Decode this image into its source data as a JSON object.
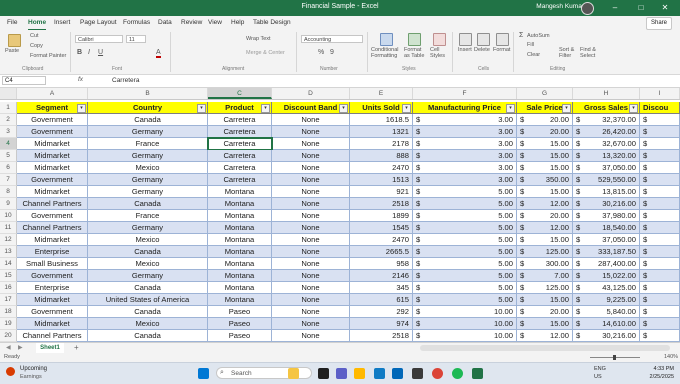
{
  "titlebar": {
    "title": "Financial Sample  -  Excel",
    "user": "Mangesh Kumar",
    "min": "–",
    "max": "□",
    "close": "✕"
  },
  "menu": {
    "tabs": [
      "File",
      "Home",
      "Insert",
      "Page Layout",
      "Formulas",
      "Data",
      "Review",
      "View",
      "Help",
      "Table Design"
    ],
    "active": "Home",
    "share": "Share"
  },
  "ribbon": {
    "paste": "Paste",
    "cut": "Cut",
    "copy": "Copy",
    "format_painter": "Format Painter",
    "font_name": "Calibri",
    "font_size": "11",
    "wrap_text": "Wrap Text",
    "merge_center": "Merge & Center",
    "number_format": "Accounting",
    "percent": "%",
    "comma": "9",
    "conditional_formatting": "Conditional Formatting",
    "format_as_table": "Format as Table",
    "cell_styles": "Cell Styles",
    "insert": "Insert",
    "delete": "Delete",
    "format": "Format",
    "autosum": "AutoSum",
    "fill": "Fill",
    "clear": "Clear",
    "sort_filter": "Sort & Filter",
    "find_select": "Find & Select",
    "groups": [
      "Clipboard",
      "Font",
      "Alignment",
      "Number",
      "Styles",
      "Cells",
      "Editing"
    ]
  },
  "formula_bar": {
    "name_box": "C4",
    "fx": "fx",
    "value": "Carretera"
  },
  "sheet": {
    "columns": [
      "A",
      "B",
      "C",
      "D",
      "E",
      "F",
      "G",
      "H",
      "I"
    ],
    "selected_column": "C",
    "selected_row": "4",
    "headers": [
      "Segment",
      "Country",
      "Product",
      "Discount Band",
      "Units Sold",
      "Manufacturing Price",
      "Sale Price",
      "Gross Sales",
      "Discou"
    ],
    "filter_glyph": "▾",
    "dollar": "$",
    "rows": [
      {
        "n": "2",
        "cells": [
          "Government",
          "Canada",
          "Carretera",
          "None",
          "1618.5",
          "3.00",
          "20.00",
          "32,370.00"
        ]
      },
      {
        "n": "3",
        "cells": [
          "Government",
          "Germany",
          "Carretera",
          "None",
          "1321",
          "3.00",
          "20.00",
          "26,420.00"
        ]
      },
      {
        "n": "4",
        "cells": [
          "Midmarket",
          "France",
          "Carretera",
          "None",
          "2178",
          "3.00",
          "15.00",
          "32,670.00"
        ]
      },
      {
        "n": "5",
        "cells": [
          "Midmarket",
          "Germany",
          "Carretera",
          "None",
          "888",
          "3.00",
          "15.00",
          "13,320.00"
        ]
      },
      {
        "n": "6",
        "cells": [
          "Midmarket",
          "Mexico",
          "Carretera",
          "None",
          "2470",
          "3.00",
          "15.00",
          "37,050.00"
        ]
      },
      {
        "n": "7",
        "cells": [
          "Government",
          "Germany",
          "Carretera",
          "None",
          "1513",
          "3.00",
          "350.00",
          "529,550.00"
        ]
      },
      {
        "n": "8",
        "cells": [
          "Midmarket",
          "Germany",
          "Montana",
          "None",
          "921",
          "5.00",
          "15.00",
          "13,815.00"
        ]
      },
      {
        "n": "9",
        "cells": [
          "Channel Partners",
          "Canada",
          "Montana",
          "None",
          "2518",
          "5.00",
          "12.00",
          "30,216.00"
        ]
      },
      {
        "n": "10",
        "cells": [
          "Government",
          "France",
          "Montana",
          "None",
          "1899",
          "5.00",
          "20.00",
          "37,980.00"
        ]
      },
      {
        "n": "11",
        "cells": [
          "Channel Partners",
          "Germany",
          "Montana",
          "None",
          "1545",
          "5.00",
          "12.00",
          "18,540.00"
        ]
      },
      {
        "n": "12",
        "cells": [
          "Midmarket",
          "Mexico",
          "Montana",
          "None",
          "2470",
          "5.00",
          "15.00",
          "37,050.00"
        ]
      },
      {
        "n": "13",
        "cells": [
          "Enterprise",
          "Canada",
          "Montana",
          "None",
          "2665.5",
          "5.00",
          "125.00",
          "333,187.50"
        ]
      },
      {
        "n": "14",
        "cells": [
          "Small Business",
          "Mexico",
          "Montana",
          "None",
          "958",
          "5.00",
          "300.00",
          "287,400.00"
        ]
      },
      {
        "n": "15",
        "cells": [
          "Government",
          "Germany",
          "Montana",
          "None",
          "2146",
          "5.00",
          "7.00",
          "15,022.00"
        ]
      },
      {
        "n": "16",
        "cells": [
          "Enterprise",
          "Canada",
          "Montana",
          "None",
          "345",
          "5.00",
          "125.00",
          "43,125.00"
        ]
      },
      {
        "n": "17",
        "cells": [
          "Midmarket",
          "United States of America",
          "Montana",
          "None",
          "615",
          "5.00",
          "15.00",
          "9,225.00"
        ]
      },
      {
        "n": "18",
        "cells": [
          "Government",
          "Canada",
          "Paseo",
          "None",
          "292",
          "10.00",
          "20.00",
          "5,840.00"
        ]
      },
      {
        "n": "19",
        "cells": [
          "Midmarket",
          "Mexico",
          "Paseo",
          "None",
          "974",
          "10.00",
          "15.00",
          "14,610.00"
        ]
      },
      {
        "n": "20",
        "cells": [
          "Channel Partners",
          "Canada",
          "Paseo",
          "None",
          "2518",
          "10.00",
          "12.00",
          "30,216.00"
        ]
      }
    ]
  },
  "sheet_tabs": {
    "active": "Sheet1",
    "add": "+"
  },
  "status": {
    "ready": "Ready",
    "zoom": "140%"
  },
  "taskbar": {
    "weather_title": "Upcoming",
    "weather_sub": "Earnings",
    "search_placeholder": "Search",
    "time": "4:33 PM",
    "date": "2/25/2025",
    "lang": "ENG",
    "region": "US"
  },
  "colors": {
    "excel_green": "#217346",
    "header_fill": "#ffff00",
    "band_fill": "#d9e1f2"
  }
}
